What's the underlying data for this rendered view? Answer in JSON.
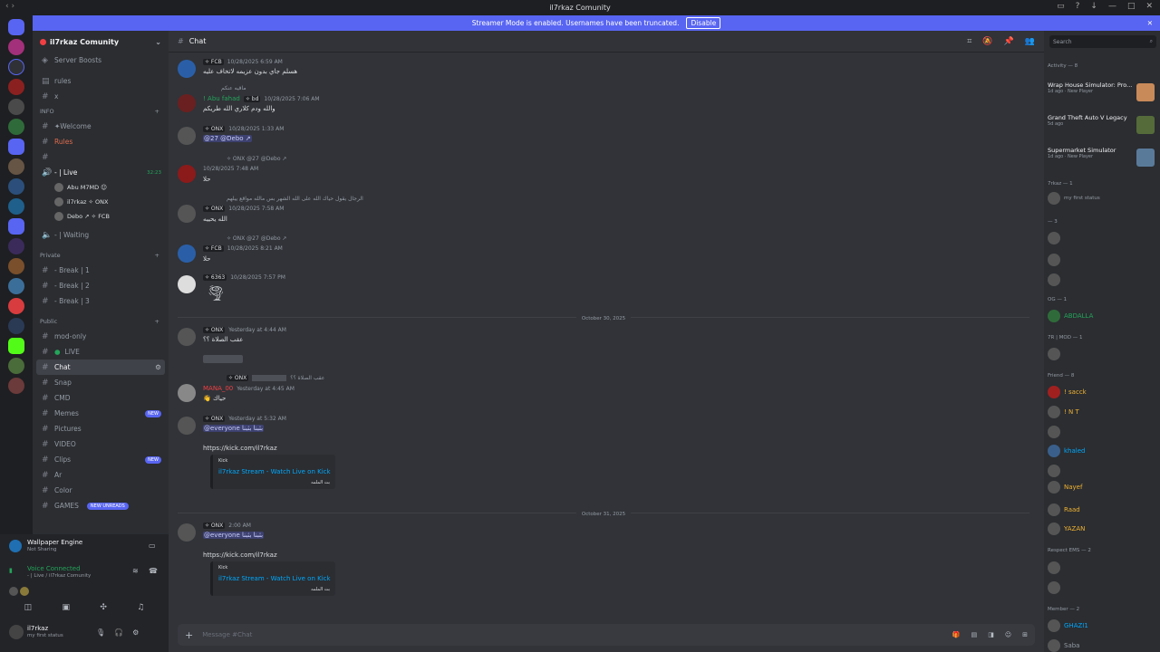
{
  "window": {
    "title": "il7rkaz Comunity"
  },
  "banner": {
    "text": "Streamer Mode is enabled. Usernames have been truncated.",
    "disable": "Disable"
  },
  "guild": {
    "name": "il7rkaz Comunity"
  },
  "channels": {
    "server_boosts": "Server Boosts",
    "rules": "rules",
    "x": "x",
    "cat_info": "INFO",
    "welcome": "✦Welcome",
    "rules2": "Rules",
    "voice_live": "- | Live",
    "voice_time": "32:23",
    "vusers": [
      "Abu M7MD ☺",
      "il7rkaz ✧ ONX",
      "Debo ↗ ✧ FCB"
    ],
    "waiting": "- | Waiting",
    "cat_private": "Private",
    "break1": "- Break | 1",
    "break2": "- Break | 2",
    "break3": "- Break | 3",
    "cat_public": "Public",
    "mod_only": "mod-only",
    "live": "LIVE",
    "chat": "Chat",
    "snap": "Snap",
    "cmd": "CMD",
    "memes": "Memes",
    "pictures": "Pictures",
    "video": "VIDEO",
    "clips": "Clips",
    "ar": "Ar",
    "color": "Color",
    "games": "GAMES",
    "new": "NEW",
    "new_unreads": "NEW UNREADS"
  },
  "bottom": {
    "we_name": "Wallpaper Engine",
    "we_status": "Not Sharing",
    "voice": "Voice Connected",
    "voice_sub": "- | Live / il7rkaz Comunity",
    "user": "il7rkaz",
    "user_status": "my first status"
  },
  "header": {
    "channel": "Chat",
    "search": "Search"
  },
  "messages": {
    "m1_tag": "✧ FCB",
    "m1_time": "10/28/2025 6:59 AM",
    "m1_body": "هسلم جاي بدون عزيمه لاتخاف عليه",
    "m2_reply": "ماقيه عنكم",
    "m2_name": "! Abu fahad",
    "m2_tag": "✧ bd",
    "m2_time": "10/28/2025 7:06 AM",
    "m2_body": "والله ودم كلاري الله طريكم",
    "m3_tag": "✧ ONX",
    "m3_time": "10/28/2025 1:33 AM",
    "m3_body": "@27 @Debo ↗",
    "m4_reply": "✧ ONX @27 @Debo ↗",
    "m4_time": "10/28/2025 7:48 AM",
    "m4_body": "حلا",
    "m5_reply": "الرجال يقول حياك الله على الله الشهر بس مالله مواقع ييلهم",
    "m5_tag": "✧ ONX",
    "m5_time": "10/28/2025 7:58 AM",
    "m5_body": "الله يحييه",
    "m6_reply": "✧ ONX @27 @Debo ↗",
    "m6_tag": "✧ FCB",
    "m6_time": "10/28/2025 8:21 AM",
    "m6_body": "حلا",
    "m7_tag": "✧ 6363",
    "m7_time": "10/28/2025 7:57 PM",
    "div1": "October 30, 2025",
    "m8_tag": "✧ ONX",
    "m8_time": "Yesterday at 4:44 AM",
    "m8_body": "عقب الصلاة ؟؟",
    "m9_reply": "عقب الصلاة ؟؟",
    "m9_name": "MANA_00",
    "m9_time": "Yesterday at 4:45 AM",
    "m9_body": "👋 حياك",
    "m10_tag": "✧ ONX",
    "m10_time": "Yesterday at 5:32 AM",
    "m10_body": "@everyone بثبنا بثبنا",
    "m10_link": "https://kick.com/il7rkaz",
    "embed_prov": "Kick",
    "embed_title": "il7rkaz Stream - Watch Live on Kick",
    "embed_desc": "بث الملمه",
    "div2": "October 31, 2025",
    "m11_tag": "✧ ONX",
    "m11_time": "2:00 AM",
    "m11_body": "@everyone بثبنا بثبنا",
    "m11_link": "https://kick.com/il7rkaz",
    "composer": "Message #Chat"
  },
  "members": {
    "activity": "Activity — 8",
    "a1": "Wrap House Simulator: Pro...",
    "a1s": "1d ago · New Player",
    "a2": "Grand Theft Auto V Legacy",
    "a2s": "5d ago",
    "a3": "Supermarket Simulator",
    "a3s": "1d ago · New Player",
    "c1": "7rkaz — 1",
    "c2": "— 3",
    "c3": "OG — 1",
    "abdalla": "ABDALLA",
    "c4": "7R | MOD — 1",
    "c5": "Friend — 8",
    "f1": "! sacck",
    "f2": "! N T",
    "f3": "khaled",
    "f4": "Nayef",
    "f5": "Raad",
    "f6": "YAZAN",
    "c6": "Respect EMS — 2",
    "c7": "Member — 2",
    "ghazi": "GHAZI1",
    "saba": "Saba",
    "my_status": "my first status"
  },
  "colors": {
    "accent": "#5865f2",
    "online": "#23a55a",
    "link": "#00a8fc"
  }
}
